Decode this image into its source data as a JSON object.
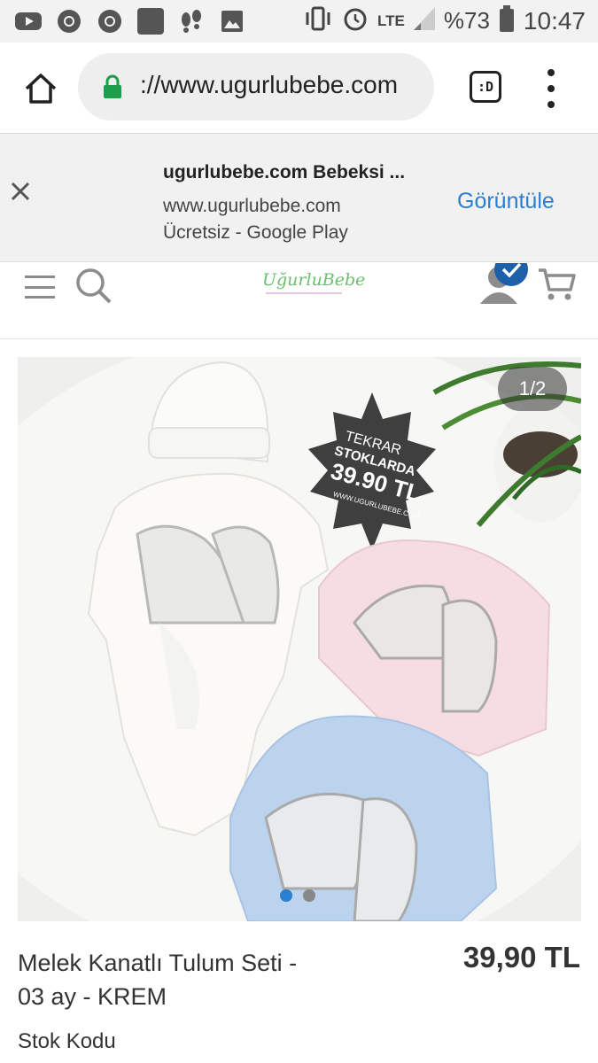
{
  "status_bar": {
    "battery": "%73",
    "network": "LTE",
    "time": "10:47",
    "left_icons": [
      "youtube-icon",
      "chrome-icon",
      "chrome-icon",
      "app-icon",
      "footsteps-icon",
      "image-icon"
    ],
    "right_icons": [
      "vibrate-icon",
      "alarm-icon",
      "signal-icon",
      "battery-icon"
    ]
  },
  "browser": {
    "url": "://www.ugurlubebe.com",
    "tab_label": ":D"
  },
  "app_banner": {
    "title": "ugurlubebe.com Bebeksi ...",
    "url": "www.ugurlubebe.com",
    "subtitle": "Ücretsiz - Google Play",
    "action_label": "Görüntüle"
  },
  "site_header": {
    "logo_text": "UğurluBebe"
  },
  "product": {
    "image_counter": "1/2",
    "badge": {
      "line1": "TEKRAR",
      "line2": "STOKLARDA",
      "line3": "39.90 TL",
      "line4": "WWW.UGURLUBEBE.COM"
    },
    "title": "Melek Kanatlı Tulum Seti - 03 ay - KREM",
    "price": "39,90 TL",
    "stock_label": "Stok Kodu",
    "carousel_dots": 2,
    "active_dot": 0
  },
  "colors": {
    "accent_blue": "#2b7fd0",
    "lock_green": "#1e9e4a",
    "logo_green": "#6cbf6e",
    "dot_active": "#2b7fd0",
    "dot_inactive": "#888888"
  }
}
